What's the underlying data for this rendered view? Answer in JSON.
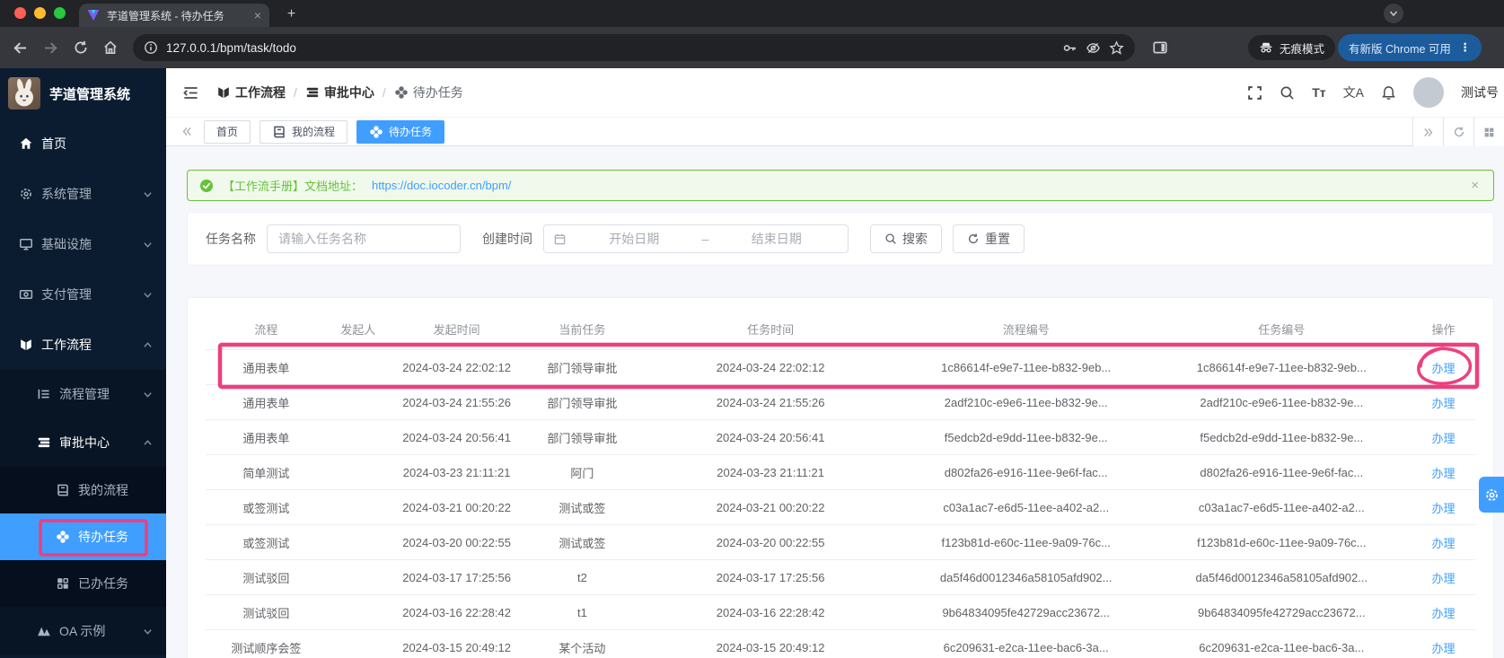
{
  "browser": {
    "tab_title": "芋道管理系统 - 待办任务",
    "url": "127.0.0.1/bpm/task/todo",
    "incognito_label": "无痕模式",
    "update_button": "有新版 Chrome 可用"
  },
  "app_title": "芋道管理系统",
  "sidebar": {
    "items": [
      {
        "key": "home",
        "label": "首页",
        "icon": "home-icon",
        "level": 1,
        "bright": true
      },
      {
        "key": "system",
        "label": "系统管理",
        "icon": "gear-icon",
        "level": 1,
        "chevron": "down"
      },
      {
        "key": "infra",
        "label": "基础设施",
        "icon": "monitor-icon",
        "level": 1,
        "chevron": "down"
      },
      {
        "key": "payment",
        "label": "支付管理",
        "icon": "payment-icon",
        "level": 1,
        "chevron": "down"
      },
      {
        "key": "workflow",
        "label": "工作流程",
        "icon": "workflow-icon",
        "level": 1,
        "chevron": "up",
        "bright": true
      },
      {
        "key": "process-mgmt",
        "label": "流程管理",
        "icon": "process-icon",
        "level": 2,
        "chevron": "down"
      },
      {
        "key": "approval-center",
        "label": "审批中心",
        "icon": "approval-icon",
        "level": 2,
        "chevron": "up",
        "bright": true
      },
      {
        "key": "my-process",
        "label": "我的流程",
        "icon": "my-process-icon",
        "level": 3
      },
      {
        "key": "todo-tasks",
        "label": "待办任务",
        "icon": "todo-icon",
        "level": 3,
        "active": true
      },
      {
        "key": "done-tasks",
        "label": "已办任务",
        "icon": "done-icon",
        "level": 3
      },
      {
        "key": "oa-example",
        "label": "OA 示例",
        "icon": "oa-icon",
        "level": 2,
        "chevron": "down"
      }
    ]
  },
  "breadcrumb": {
    "items": [
      {
        "key": "workflow",
        "label": "工作流程",
        "icon": "workflow-icon"
      },
      {
        "key": "approval-center",
        "label": "审批中心",
        "icon": "approval-icon"
      },
      {
        "key": "todo-tasks",
        "label": "待办任务",
        "icon": "todo-icon"
      }
    ]
  },
  "header": {
    "username": "测试号",
    "icons": [
      "fullscreen-icon",
      "search-icon",
      "font-size-icon",
      "translate-icon",
      "bell-icon"
    ]
  },
  "tabs": {
    "items": [
      {
        "key": "home",
        "label": "首页"
      },
      {
        "key": "my-process",
        "label": "我的流程",
        "icon": "my-process-icon"
      },
      {
        "key": "todo-tasks",
        "label": "待办任务",
        "icon": "todo-icon",
        "active": true
      }
    ]
  },
  "alert": {
    "prefix": "【工作流手册】文档地址：",
    "link": "https://doc.iocoder.cn/bpm/"
  },
  "filters": {
    "task_name_label": "任务名称",
    "task_name_placeholder": "请输入任务名称",
    "create_time_label": "创建时间",
    "start_placeholder": "开始日期",
    "separator": "–",
    "end_placeholder": "结束日期",
    "search_button": "搜索",
    "reset_button": "重置"
  },
  "table": {
    "columns": [
      "流程",
      "发起人",
      "发起时间",
      "当前任务",
      "任务时间",
      "流程编号",
      "任务编号",
      "操作"
    ],
    "action_label": "办理",
    "rows": [
      {
        "process": "通用表单",
        "initiator": "",
        "start_time": "2024-03-24 22:02:12",
        "current_task": "部门领导审批",
        "task_time": "2024-03-24 22:02:12",
        "process_id": "1c86614f-e9e7-11ee-b832-9eb...",
        "task_id": "1c86614f-e9e7-11ee-b832-9eb..."
      },
      {
        "process": "通用表单",
        "initiator": "",
        "start_time": "2024-03-24 21:55:26",
        "current_task": "部门领导审批",
        "task_time": "2024-03-24 21:55:26",
        "process_id": "2adf210c-e9e6-11ee-b832-9e...",
        "task_id": "2adf210c-e9e6-11ee-b832-9e..."
      },
      {
        "process": "通用表单",
        "initiator": "",
        "start_time": "2024-03-24 20:56:41",
        "current_task": "部门领导审批",
        "task_time": "2024-03-24 20:56:41",
        "process_id": "f5edcb2d-e9dd-11ee-b832-9e...",
        "task_id": "f5edcb2d-e9dd-11ee-b832-9e..."
      },
      {
        "process": "简单测试",
        "initiator": "",
        "start_time": "2024-03-23 21:11:21",
        "current_task": "阿门",
        "task_time": "2024-03-23 21:11:21",
        "process_id": "d802fa26-e916-11ee-9e6f-fac...",
        "task_id": "d802fa26-e916-11ee-9e6f-fac..."
      },
      {
        "process": "或签测试",
        "initiator": "",
        "start_time": "2024-03-21 00:20:22",
        "current_task": "测试或签",
        "task_time": "2024-03-21 00:20:22",
        "process_id": "c03a1ac7-e6d5-11ee-a402-a2...",
        "task_id": "c03a1ac7-e6d5-11ee-a402-a2..."
      },
      {
        "process": "或签测试",
        "initiator": "",
        "start_time": "2024-03-20 00:22:55",
        "current_task": "测试或签",
        "task_time": "2024-03-20 00:22:55",
        "process_id": "f123b81d-e60c-11ee-9a09-76c...",
        "task_id": "f123b81d-e60c-11ee-9a09-76c..."
      },
      {
        "process": "测试驳回",
        "initiator": "",
        "start_time": "2024-03-17 17:25:56",
        "current_task": "t2",
        "task_time": "2024-03-17 17:25:56",
        "process_id": "da5f46d0012346a58105afd902...",
        "task_id": "da5f46d0012346a58105afd902..."
      },
      {
        "process": "测试驳回",
        "initiator": "",
        "start_time": "2024-03-16 22:28:42",
        "current_task": "t1",
        "task_time": "2024-03-16 22:28:42",
        "process_id": "9b64834095fe42729acc23672...",
        "task_id": "9b64834095fe42729acc23672..."
      },
      {
        "process": "测试顺序会签",
        "initiator": "",
        "start_time": "2024-03-15 20:49:12",
        "current_task": "某个活动",
        "task_time": "2024-03-15 20:49:12",
        "process_id": "6c209631-e2ca-11ee-bac6-3a...",
        "task_id": "6c209631-e2ca-11ee-bac6-3a..."
      }
    ]
  },
  "colors": {
    "accent": "#409eff",
    "success": "#67c23a",
    "annotation": "#ee3f7d",
    "sidebar_bg": "#0c1c30"
  }
}
